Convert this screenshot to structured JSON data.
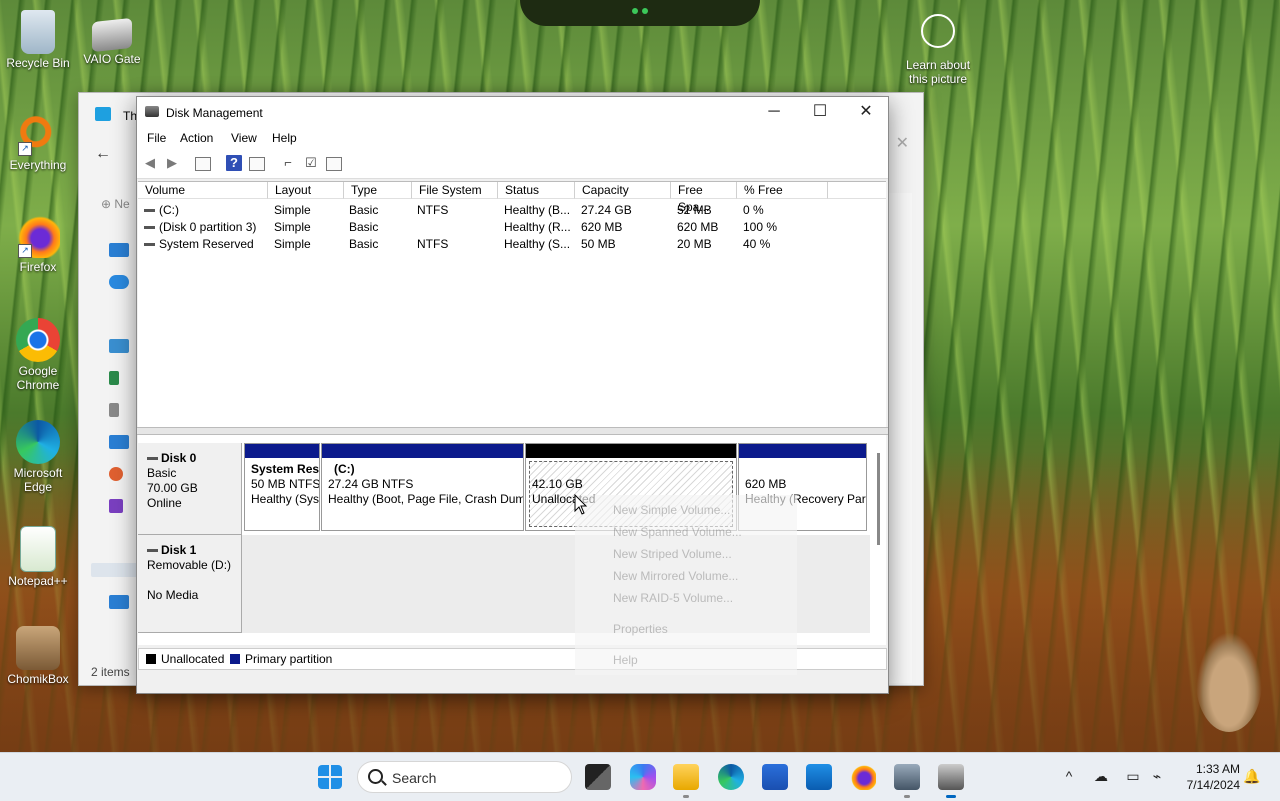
{
  "desktop": {
    "icons": [
      {
        "label": "Recycle Bin"
      },
      {
        "label": "VAIO Gate"
      },
      {
        "label": "Everything"
      },
      {
        "label": "Firefox"
      },
      {
        "label": "Google Chrome"
      },
      {
        "label": "Microsoft Edge"
      },
      {
        "label": "Notepad++"
      },
      {
        "label": "ChomikBox"
      }
    ],
    "learn_picture": "Learn about this picture"
  },
  "explorer": {
    "title": "Thi",
    "new_label": "Ne",
    "items_count": "2 items"
  },
  "disk_mgmt": {
    "title": "Disk Management",
    "menu": [
      "File",
      "Action",
      "View",
      "Help"
    ],
    "columns": [
      "Volume",
      "Layout",
      "Type",
      "File System",
      "Status",
      "Capacity",
      "Free Spa...",
      "% Free"
    ],
    "volumes": [
      {
        "volume": "(C:)",
        "layout": "Simple",
        "type": "Basic",
        "fs": "NTFS",
        "status": "Healthy (B...",
        "capacity": "27.24 GB",
        "free": "52 MB",
        "pct": "0 %"
      },
      {
        "volume": "(Disk 0 partition 3)",
        "layout": "Simple",
        "type": "Basic",
        "fs": "",
        "status": "Healthy (R...",
        "capacity": "620 MB",
        "free": "620 MB",
        "pct": "100 %"
      },
      {
        "volume": "System Reserved",
        "layout": "Simple",
        "type": "Basic",
        "fs": "NTFS",
        "status": "Healthy (S...",
        "capacity": "50 MB",
        "free": "20 MB",
        "pct": "40 %"
      }
    ],
    "disk0": {
      "name": "Disk 0",
      "type": "Basic",
      "size": "70.00 GB",
      "state": "Online",
      "partitions": [
        {
          "name": "System Res",
          "size": "50 MB NTFS",
          "status": "Healthy (Sys"
        },
        {
          "name": "(C:)",
          "size": "27.24 GB NTFS",
          "status": "Healthy (Boot, Page File, Crash Dum"
        },
        {
          "name": "",
          "size": "42.10 GB",
          "status": "Unallocated"
        },
        {
          "name": "",
          "size": "620 MB",
          "status": "Healthy (Recovery Par"
        }
      ]
    },
    "disk1": {
      "name": "Disk 1",
      "type": "Removable (D:)",
      "state": "No Media"
    },
    "legend": {
      "unallocated": "Unallocated",
      "primary": "Primary partition",
      "colors": {
        "unallocated": "#000000",
        "primary": "#0b1a8c"
      }
    },
    "context_menu": [
      "New Simple Volume...",
      "New Spanned Volume...",
      "New Striped Volume...",
      "New Mirrored Volume...",
      "New RAID-5 Volume...",
      "Properties",
      "Help"
    ]
  },
  "taskbar": {
    "search_placeholder": "Search",
    "time": "1:33 AM",
    "date": "7/14/2024",
    "accent": "#0067c0"
  }
}
